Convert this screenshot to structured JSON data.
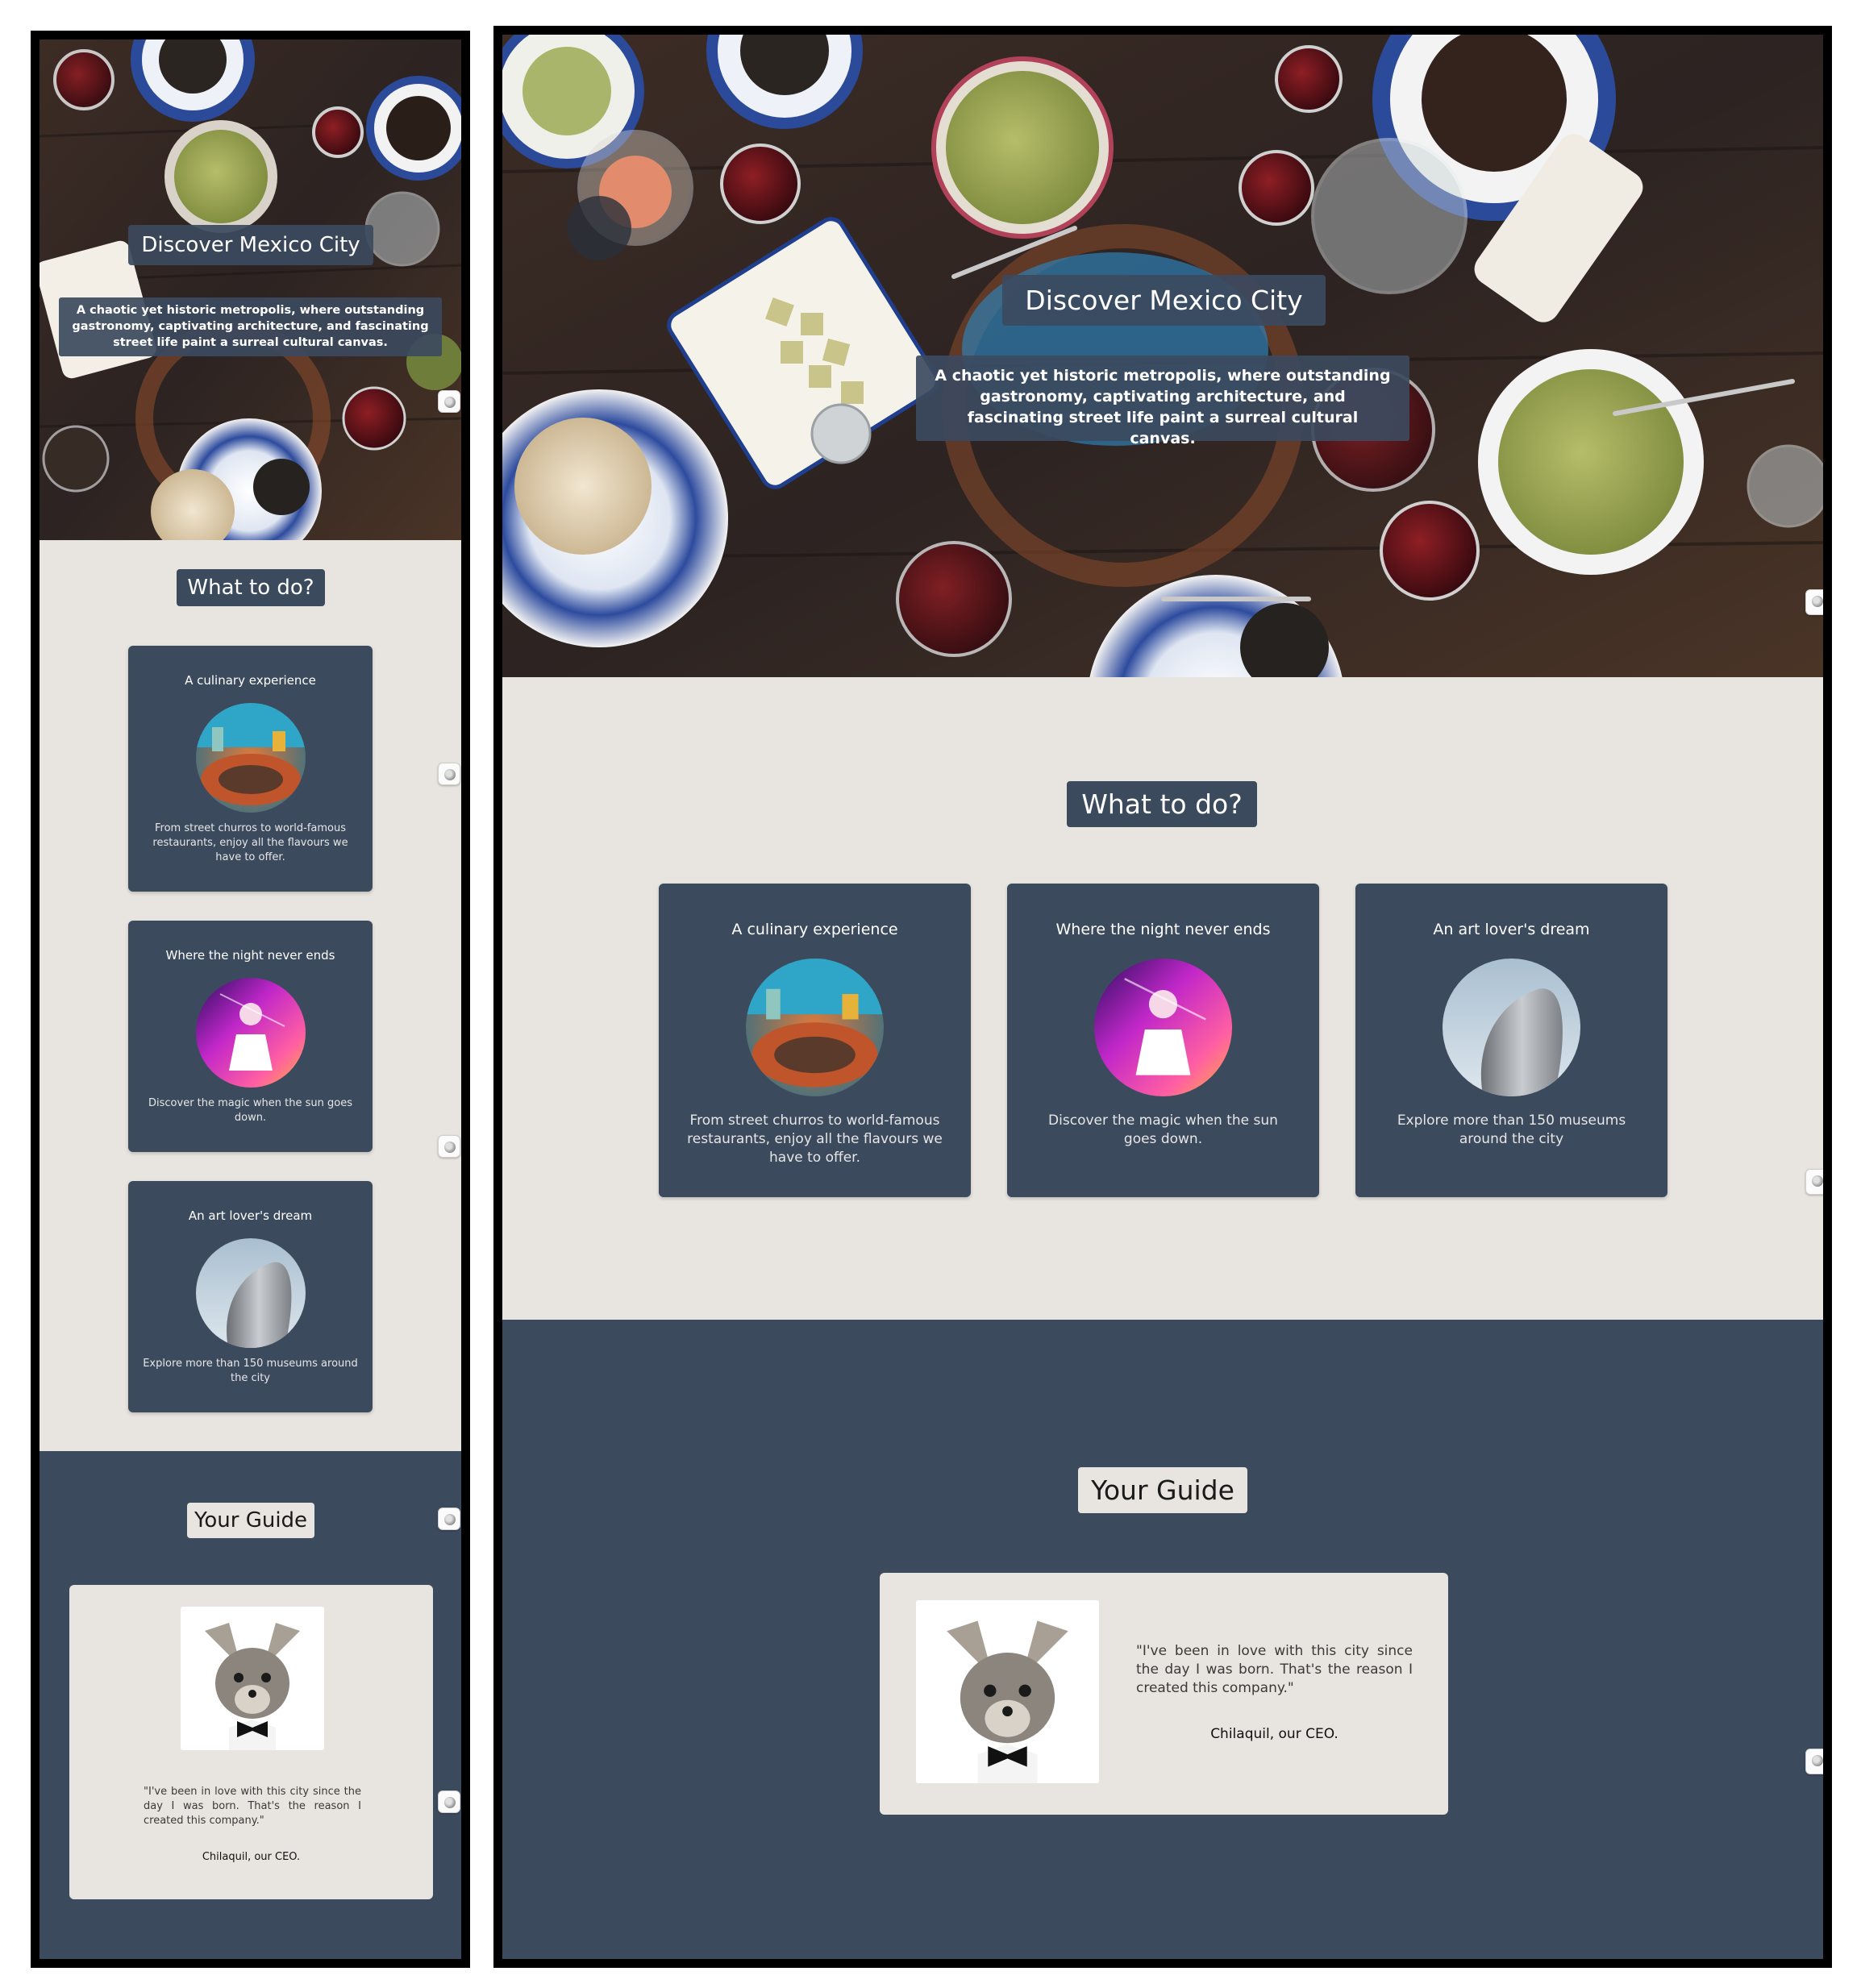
{
  "hero": {
    "title": "Discover Mexico City",
    "subtitle": "A chaotic yet historic metropolis, where outstanding gastronomy, captivating architecture, and fascinating street life paint a surreal cultural canvas."
  },
  "activities": {
    "heading": "What to do?",
    "cards": [
      {
        "title": "A culinary experience",
        "description": "From street churros to world-famous restaurants, enjoy all the flavours we have to offer."
      },
      {
        "title": "Where the night never ends",
        "description": "Discover the magic when the sun goes down."
      },
      {
        "title": "An art lover's dream",
        "description": "Explore more than 150 museums around the city"
      }
    ]
  },
  "guide": {
    "heading": "Your Guide",
    "quote": "\"I've been in love with this city since the day I was born. That's the reason I created this company.\"",
    "signature": "Chilaquil, our CEO."
  },
  "colors": {
    "navy": "#3c4a5e",
    "cream": "#e8e4df",
    "frame": "#000000"
  },
  "icons": {
    "scroll_button": "scroll-anchor-icon"
  }
}
